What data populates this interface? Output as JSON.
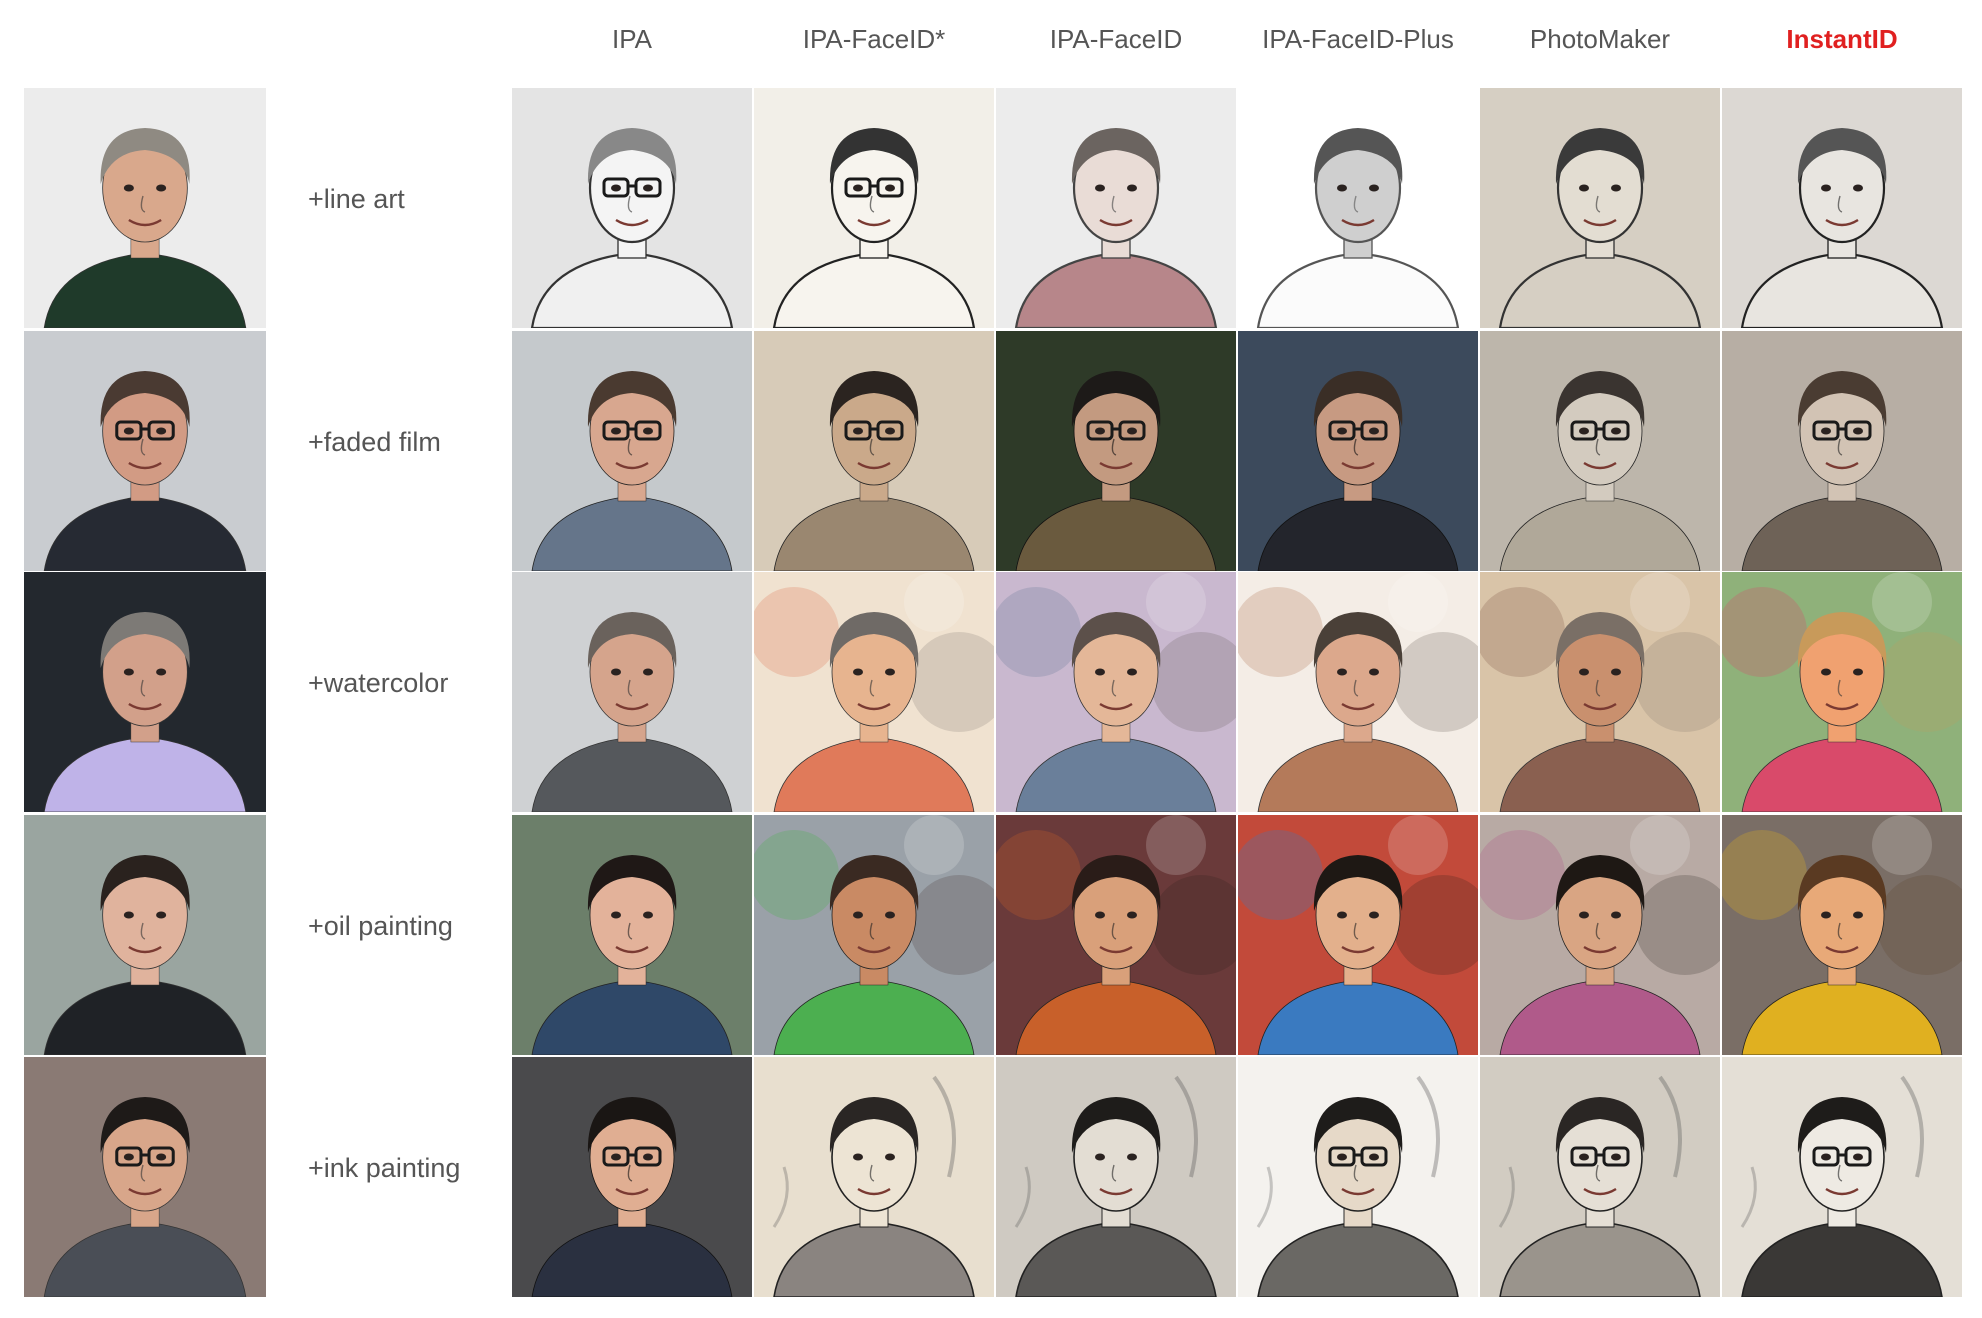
{
  "figure": {
    "columns": [
      {
        "label": "IPA",
        "highlight": false
      },
      {
        "label": "IPA-FaceID*",
        "highlight": false
      },
      {
        "label": "IPA-FaceID",
        "highlight": false
      },
      {
        "label": "IPA-FaceID-Plus",
        "highlight": false
      },
      {
        "label": "PhotoMaker",
        "highlight": false
      },
      {
        "label": "InstantID",
        "highlight": true
      }
    ],
    "highlight_color": "#e02020",
    "rows": [
      {
        "prompt": "+line art",
        "reference": {
          "bg": "#ececec",
          "skin": "#d9a88c",
          "hair": "#8f8a82",
          "shirt": "#1f3a2a",
          "glasses": false
        },
        "cells": [
          {
            "bg": "#e4e4e4",
            "skin": "#f4f4f4",
            "hair": "#888888",
            "shirt": "#f0f0f0",
            "line": "#333333",
            "glasses": true,
            "style": "lineart"
          },
          {
            "bg": "#f2efe8",
            "skin": "#f7f4ee",
            "hair": "#333333",
            "shirt": "#f7f4ee",
            "line": "#222222",
            "glasses": true,
            "style": "lineart"
          },
          {
            "bg": "#ececec",
            "skin": "#e9dcd6",
            "hair": "#6b6460",
            "shirt": "#b7868a",
            "line": "#444444",
            "glasses": false,
            "style": "lineart"
          },
          {
            "bg": "#ffffff",
            "skin": "#cfcfcf",
            "hair": "#555555",
            "shirt": "#fbfbfb",
            "line": "#555555",
            "glasses": false,
            "style": "lineart"
          },
          {
            "bg": "#d6cfc3",
            "skin": "#e3ddd2",
            "hair": "#3a3a3a",
            "shirt": "#d6cfc3",
            "line": "#333333",
            "glasses": false,
            "style": "lineart"
          },
          {
            "bg": "#dcd8d3",
            "skin": "#e8e5e0",
            "hair": "#555555",
            "shirt": "#e8e5e0",
            "line": "#222222",
            "glasses": false,
            "style": "lineart"
          }
        ]
      },
      {
        "prompt": "+faded film",
        "reference": {
          "bg": "#c9ccd0",
          "skin": "#d29b84",
          "hair": "#4a3a32",
          "shirt": "#262a33",
          "glasses": true
        },
        "cells": [
          {
            "bg": "#c5c9cc",
            "skin": "#d8a78f",
            "hair": "#4a3a30",
            "shirt": "#65758a",
            "line": "#222222",
            "glasses": true,
            "style": "photo"
          },
          {
            "bg": "#d7cbb8",
            "skin": "#caa98a",
            "hair": "#2b2420",
            "shirt": "#9a8770",
            "line": "#222222",
            "glasses": true,
            "style": "photo"
          },
          {
            "bg": "#2e3a28",
            "skin": "#c39a80",
            "hair": "#1d1a18",
            "shirt": "#6a5a3e",
            "line": "#111111",
            "glasses": true,
            "style": "photo"
          },
          {
            "bg": "#3c4a5c",
            "skin": "#c79a82",
            "hair": "#3a2e26",
            "shirt": "#23252c",
            "line": "#111111",
            "glasses": true,
            "style": "photo"
          },
          {
            "bg": "#bdb6ab",
            "skin": "#d3cbbf",
            "hair": "#3a3430",
            "shirt": "#b0a899",
            "line": "#222222",
            "glasses": true,
            "style": "photo"
          },
          {
            "bg": "#b7aea4",
            "skin": "#d2c3b4",
            "hair": "#4a3c32",
            "shirt": "#6e6257",
            "line": "#222222",
            "glasses": true,
            "style": "photo"
          }
        ]
      },
      {
        "prompt": "+watercolor",
        "reference": {
          "bg": "#23282e",
          "skin": "#d2a08a",
          "hair": "#7d7a76",
          "shirt": "#bfb3e8",
          "glasses": false
        },
        "cells": [
          {
            "bg": "#cfd1d3",
            "skin": "#d5a48c",
            "hair": "#6a625c",
            "shirt": "#55585c",
            "line": "#333333",
            "glasses": false,
            "style": "photo"
          },
          {
            "bg": "#f0e2d0",
            "skin": "#e7b48f",
            "hair": "#6f6a66",
            "shirt": "#e07a5a",
            "line": "#333333",
            "glasses": false,
            "style": "paint"
          },
          {
            "bg": "#c9b8cf",
            "skin": "#e4b798",
            "hair": "#5c504a",
            "shirt": "#6a7f9a",
            "line": "#333333",
            "glasses": false,
            "style": "paint"
          },
          {
            "bg": "#f4ede6",
            "skin": "#dca88c",
            "hair": "#4a4038",
            "shirt": "#b47a5a",
            "line": "#333333",
            "glasses": false,
            "style": "paint"
          },
          {
            "bg": "#d9c4a8",
            "skin": "#c9906e",
            "hair": "#7a6f66",
            "shirt": "#8a6050",
            "line": "#333333",
            "glasses": false,
            "style": "paint"
          },
          {
            "bg": "#8fb17a",
            "skin": "#f0a170",
            "hair": "#c89a5a",
            "shirt": "#d94a6a",
            "line": "#333333",
            "glasses": false,
            "style": "paint"
          }
        ]
      },
      {
        "prompt": "+oil painting",
        "reference": {
          "bg": "#9aa5a0",
          "skin": "#e0b39d",
          "hair": "#2a221e",
          "shirt": "#1f2226",
          "glasses": false
        },
        "cells": [
          {
            "bg": "#6c7f6a",
            "skin": "#e3b29a",
            "hair": "#1f1816",
            "shirt": "#2f4868",
            "line": "#222222",
            "glasses": false,
            "style": "photo"
          },
          {
            "bg": "#9aa1a8",
            "skin": "#c98a64",
            "hair": "#3a2a22",
            "shirt": "#4caf50",
            "line": "#222222",
            "glasses": false,
            "style": "paint"
          },
          {
            "bg": "#6a3a3a",
            "skin": "#d9a07a",
            "hair": "#2a1c18",
            "shirt": "#c8602a",
            "line": "#222222",
            "glasses": false,
            "style": "paint"
          },
          {
            "bg": "#c24a3a",
            "skin": "#e3b08c",
            "hair": "#1e1814",
            "shirt": "#3a7ac0",
            "line": "#222222",
            "glasses": false,
            "style": "paint"
          },
          {
            "bg": "#b8aaa4",
            "skin": "#d9a583",
            "hair": "#1e1814",
            "shirt": "#b05a8a",
            "line": "#222222",
            "glasses": false,
            "style": "paint"
          },
          {
            "bg": "#7a6e66",
            "skin": "#e8a978",
            "hair": "#5a3a22",
            "shirt": "#e0b020",
            "line": "#222222",
            "glasses": false,
            "style": "paint"
          }
        ]
      },
      {
        "prompt": "+ink painting",
        "reference": {
          "bg": "#8a7a74",
          "skin": "#d8a68a",
          "hair": "#1e1a18",
          "shirt": "#4a4e56",
          "glasses": true
        },
        "cells": [
          {
            "bg": "#4a4a4c",
            "skin": "#e0ae92",
            "hair": "#1a1614",
            "shirt": "#2a3040",
            "line": "#111111",
            "glasses": true,
            "style": "photo"
          },
          {
            "bg": "#e8dfcf",
            "skin": "#ede4d4",
            "hair": "#2a2624",
            "shirt": "#8a8480",
            "line": "#222222",
            "glasses": false,
            "style": "ink"
          },
          {
            "bg": "#cfcac2",
            "skin": "#e3ddd3",
            "hair": "#1e1c1a",
            "shirt": "#5a5856",
            "line": "#222222",
            "glasses": false,
            "style": "ink"
          },
          {
            "bg": "#f4f2ee",
            "skin": "#e6d9c8",
            "hair": "#1e1c1a",
            "shirt": "#6a6864",
            "line": "#222222",
            "glasses": true,
            "style": "ink"
          },
          {
            "bg": "#d2ccc2",
            "skin": "#e5dfd5",
            "hair": "#2a2624",
            "shirt": "#9a948c",
            "line": "#222222",
            "glasses": true,
            "style": "ink"
          },
          {
            "bg": "#e4dfd6",
            "skin": "#eeeae3",
            "hair": "#1e1c1a",
            "shirt": "#3a3836",
            "line": "#222222",
            "glasses": true,
            "style": "ink"
          }
        ]
      }
    ]
  }
}
